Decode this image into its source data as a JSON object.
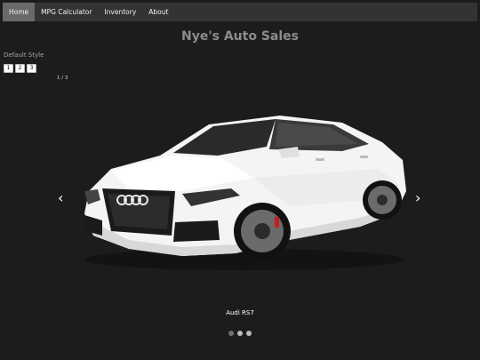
{
  "nav": {
    "items": [
      {
        "label": "Home"
      },
      {
        "label": "MPG Calculator"
      },
      {
        "label": "Inventory"
      },
      {
        "label": "About"
      }
    ]
  },
  "header": {
    "title": "Nye's Auto Sales"
  },
  "slideshow": {
    "style_label": "Default Style",
    "page_buttons": [
      "1",
      "2",
      "3"
    ],
    "counter": "1 / 3",
    "prev_icon": "chevron-left-icon",
    "next_icon": "chevron-right-icon",
    "prev_symbol": "‹",
    "next_symbol": "›",
    "caption": "Audi RS7",
    "active_dot": 0,
    "dot_count": 3
  },
  "colors": {
    "background": "#1c1c1c",
    "navbar": "#333333",
    "nav_active": "#696969",
    "title": "#8c8c8c",
    "dot": "#bbbbbb",
    "dot_active": "#717171"
  }
}
